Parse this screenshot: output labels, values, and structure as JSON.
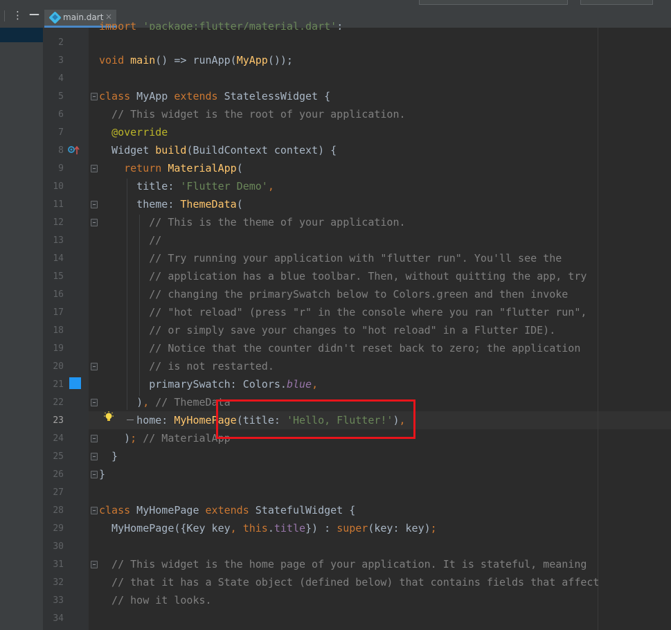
{
  "toolbar": {
    "menu_icon": "⋮",
    "minimize_icon": "—"
  },
  "tab": {
    "label": "main.dart",
    "close": "×",
    "icon": "dart-file-icon"
  },
  "gutter_icons": {
    "override": "override-marker-icon",
    "color_swatch": "#2196f3",
    "bulb": "lightbulb-icon"
  },
  "editor": {
    "partial_top": "import 'package:flutter/material.dart';",
    "lines": [
      {
        "n": "2",
        "t": ""
      },
      {
        "n": "3",
        "t": "void main() => runApp(MyApp());"
      },
      {
        "n": "4",
        "t": ""
      },
      {
        "n": "5",
        "t": "class MyApp extends StatelessWidget {"
      },
      {
        "n": "6",
        "t": "  // This widget is the root of your application."
      },
      {
        "n": "7",
        "t": "  @override"
      },
      {
        "n": "8",
        "t": "  Widget build(BuildContext context) {"
      },
      {
        "n": "9",
        "t": "    return MaterialApp("
      },
      {
        "n": "10",
        "t": "      title: 'Flutter Demo',"
      },
      {
        "n": "11",
        "t": "      theme: ThemeData("
      },
      {
        "n": "12",
        "t": "        // This is the theme of your application."
      },
      {
        "n": "13",
        "t": "        //"
      },
      {
        "n": "14",
        "t": "        // Try running your application with \"flutter run\". You'll see the"
      },
      {
        "n": "15",
        "t": "        // application has a blue toolbar. Then, without quitting the app, try"
      },
      {
        "n": "16",
        "t": "        // changing the primarySwatch below to Colors.green and then invoke"
      },
      {
        "n": "17",
        "t": "        // \"hot reload\" (press \"r\" in the console where you ran \"flutter run\","
      },
      {
        "n": "18",
        "t": "        // or simply save your changes to \"hot reload\" in a Flutter IDE)."
      },
      {
        "n": "19",
        "t": "        // Notice that the counter didn't reset back to zero; the application"
      },
      {
        "n": "20",
        "t": "        // is not restarted."
      },
      {
        "n": "21",
        "t": "        primarySwatch: Colors.blue,"
      },
      {
        "n": "22",
        "t": "      ), // ThemeData"
      },
      {
        "n": "23",
        "t": "      home: MyHomePage(title: 'Hello, Flutter!'),"
      },
      {
        "n": "24",
        "t": "    ); // MaterialApp"
      },
      {
        "n": "25",
        "t": "  }"
      },
      {
        "n": "26",
        "t": "}"
      },
      {
        "n": "27",
        "t": ""
      },
      {
        "n": "28",
        "t": "class MyHomePage extends StatefulWidget {"
      },
      {
        "n": "29",
        "t": "  MyHomePage({Key key, this.title}) : super(key: key);"
      },
      {
        "n": "30",
        "t": ""
      },
      {
        "n": "31",
        "t": "  // This widget is the home page of your application. It is stateful, meaning"
      },
      {
        "n": "32",
        "t": "  // that it has a State object (defined below) that contains fields that affect"
      },
      {
        "n": "33",
        "t": "  // how it looks."
      },
      {
        "n": "34",
        "t": ""
      }
    ]
  }
}
